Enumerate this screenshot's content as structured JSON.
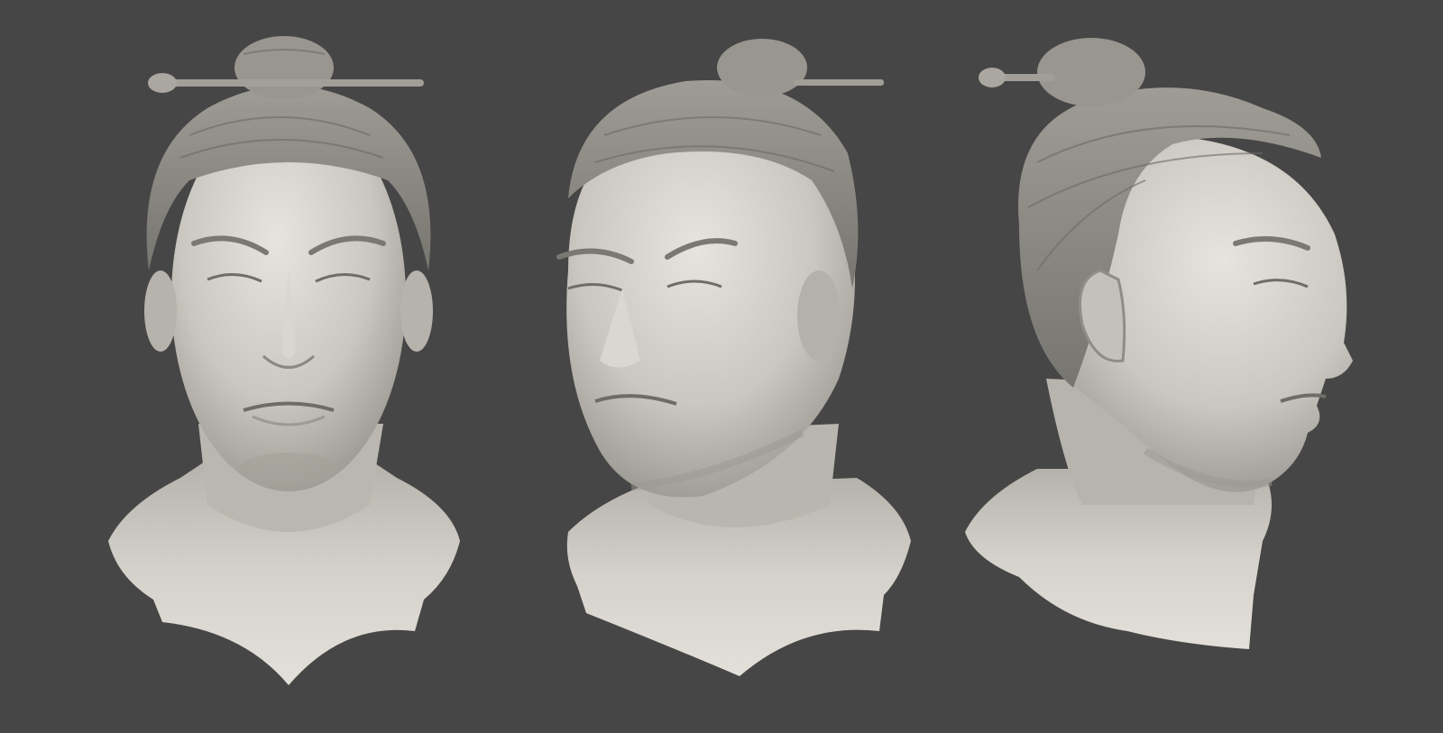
{
  "scene": {
    "background_color": "#464646",
    "clay_color": "#c4c2ba",
    "clay_shadow_color": "#8d8b84",
    "clay_highlight_color": "#e4e2da",
    "views": [
      {
        "view": "front",
        "icon": "sculpted-head-front-icon"
      },
      {
        "view": "three-quarter",
        "icon": "sculpted-head-three-quarter-icon"
      },
      {
        "view": "side",
        "icon": "sculpted-head-side-icon"
      }
    ]
  }
}
